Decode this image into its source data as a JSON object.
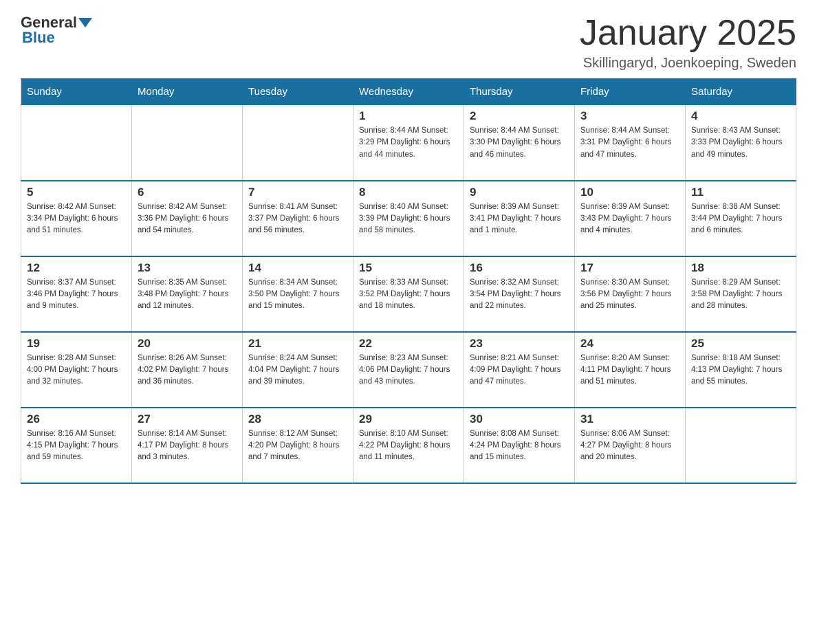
{
  "header": {
    "logo_general": "General",
    "logo_blue": "Blue",
    "month_title": "January 2025",
    "location": "Skillingaryd, Joenkoeping, Sweden"
  },
  "days_of_week": [
    "Sunday",
    "Monday",
    "Tuesday",
    "Wednesday",
    "Thursday",
    "Friday",
    "Saturday"
  ],
  "weeks": [
    [
      {
        "day": "",
        "info": ""
      },
      {
        "day": "",
        "info": ""
      },
      {
        "day": "",
        "info": ""
      },
      {
        "day": "1",
        "info": "Sunrise: 8:44 AM\nSunset: 3:29 PM\nDaylight: 6 hours\nand 44 minutes."
      },
      {
        "day": "2",
        "info": "Sunrise: 8:44 AM\nSunset: 3:30 PM\nDaylight: 6 hours\nand 46 minutes."
      },
      {
        "day": "3",
        "info": "Sunrise: 8:44 AM\nSunset: 3:31 PM\nDaylight: 6 hours\nand 47 minutes."
      },
      {
        "day": "4",
        "info": "Sunrise: 8:43 AM\nSunset: 3:33 PM\nDaylight: 6 hours\nand 49 minutes."
      }
    ],
    [
      {
        "day": "5",
        "info": "Sunrise: 8:42 AM\nSunset: 3:34 PM\nDaylight: 6 hours\nand 51 minutes."
      },
      {
        "day": "6",
        "info": "Sunrise: 8:42 AM\nSunset: 3:36 PM\nDaylight: 6 hours\nand 54 minutes."
      },
      {
        "day": "7",
        "info": "Sunrise: 8:41 AM\nSunset: 3:37 PM\nDaylight: 6 hours\nand 56 minutes."
      },
      {
        "day": "8",
        "info": "Sunrise: 8:40 AM\nSunset: 3:39 PM\nDaylight: 6 hours\nand 58 minutes."
      },
      {
        "day": "9",
        "info": "Sunrise: 8:39 AM\nSunset: 3:41 PM\nDaylight: 7 hours\nand 1 minute."
      },
      {
        "day": "10",
        "info": "Sunrise: 8:39 AM\nSunset: 3:43 PM\nDaylight: 7 hours\nand 4 minutes."
      },
      {
        "day": "11",
        "info": "Sunrise: 8:38 AM\nSunset: 3:44 PM\nDaylight: 7 hours\nand 6 minutes."
      }
    ],
    [
      {
        "day": "12",
        "info": "Sunrise: 8:37 AM\nSunset: 3:46 PM\nDaylight: 7 hours\nand 9 minutes."
      },
      {
        "day": "13",
        "info": "Sunrise: 8:35 AM\nSunset: 3:48 PM\nDaylight: 7 hours\nand 12 minutes."
      },
      {
        "day": "14",
        "info": "Sunrise: 8:34 AM\nSunset: 3:50 PM\nDaylight: 7 hours\nand 15 minutes."
      },
      {
        "day": "15",
        "info": "Sunrise: 8:33 AM\nSunset: 3:52 PM\nDaylight: 7 hours\nand 18 minutes."
      },
      {
        "day": "16",
        "info": "Sunrise: 8:32 AM\nSunset: 3:54 PM\nDaylight: 7 hours\nand 22 minutes."
      },
      {
        "day": "17",
        "info": "Sunrise: 8:30 AM\nSunset: 3:56 PM\nDaylight: 7 hours\nand 25 minutes."
      },
      {
        "day": "18",
        "info": "Sunrise: 8:29 AM\nSunset: 3:58 PM\nDaylight: 7 hours\nand 28 minutes."
      }
    ],
    [
      {
        "day": "19",
        "info": "Sunrise: 8:28 AM\nSunset: 4:00 PM\nDaylight: 7 hours\nand 32 minutes."
      },
      {
        "day": "20",
        "info": "Sunrise: 8:26 AM\nSunset: 4:02 PM\nDaylight: 7 hours\nand 36 minutes."
      },
      {
        "day": "21",
        "info": "Sunrise: 8:24 AM\nSunset: 4:04 PM\nDaylight: 7 hours\nand 39 minutes."
      },
      {
        "day": "22",
        "info": "Sunrise: 8:23 AM\nSunset: 4:06 PM\nDaylight: 7 hours\nand 43 minutes."
      },
      {
        "day": "23",
        "info": "Sunrise: 8:21 AM\nSunset: 4:09 PM\nDaylight: 7 hours\nand 47 minutes."
      },
      {
        "day": "24",
        "info": "Sunrise: 8:20 AM\nSunset: 4:11 PM\nDaylight: 7 hours\nand 51 minutes."
      },
      {
        "day": "25",
        "info": "Sunrise: 8:18 AM\nSunset: 4:13 PM\nDaylight: 7 hours\nand 55 minutes."
      }
    ],
    [
      {
        "day": "26",
        "info": "Sunrise: 8:16 AM\nSunset: 4:15 PM\nDaylight: 7 hours\nand 59 minutes."
      },
      {
        "day": "27",
        "info": "Sunrise: 8:14 AM\nSunset: 4:17 PM\nDaylight: 8 hours\nand 3 minutes."
      },
      {
        "day": "28",
        "info": "Sunrise: 8:12 AM\nSunset: 4:20 PM\nDaylight: 8 hours\nand 7 minutes."
      },
      {
        "day": "29",
        "info": "Sunrise: 8:10 AM\nSunset: 4:22 PM\nDaylight: 8 hours\nand 11 minutes."
      },
      {
        "day": "30",
        "info": "Sunrise: 8:08 AM\nSunset: 4:24 PM\nDaylight: 8 hours\nand 15 minutes."
      },
      {
        "day": "31",
        "info": "Sunrise: 8:06 AM\nSunset: 4:27 PM\nDaylight: 8 hours\nand 20 minutes."
      },
      {
        "day": "",
        "info": ""
      }
    ]
  ]
}
